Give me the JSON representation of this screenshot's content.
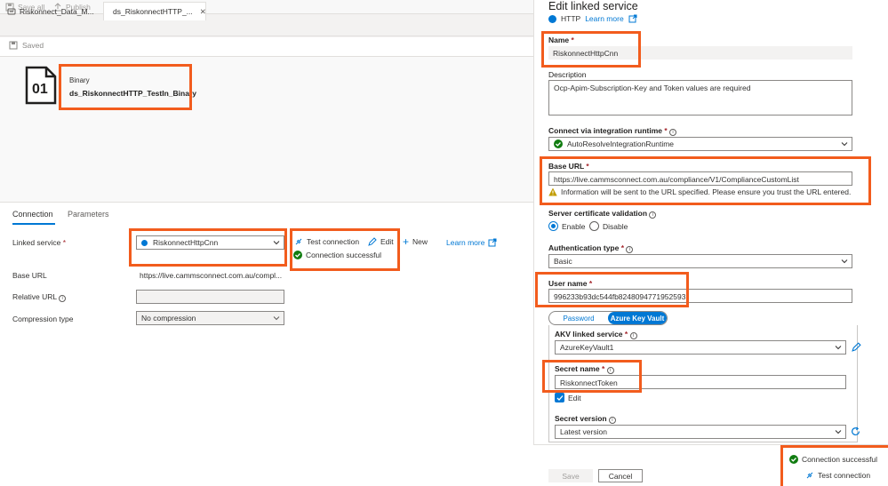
{
  "toolbar": {
    "save_all": "Save all",
    "publish": "Publish"
  },
  "tabs": [
    {
      "label": "Riskonnect_Data_M..."
    },
    {
      "label": "ds_RiskonnectHTTP_..."
    }
  ],
  "saved_label": "Saved",
  "dataset": {
    "icon_text": "01",
    "type": "Binary",
    "name": "ds_RiskonnectHTTP_TestIn_Binary"
  },
  "lower_tabs": {
    "connection": "Connection",
    "parameters": "Parameters"
  },
  "linked_service": {
    "label": "Linked service",
    "required": "*",
    "value": "RiskonnectHttpCnn",
    "test_connection": "Test connection",
    "edit": "Edit",
    "new": "New",
    "learn_more": "Learn more",
    "status": "Connection successful"
  },
  "base_url": {
    "label": "Base URL",
    "value": "https://live.cammsconnect.com.au/compl..."
  },
  "relative_url": {
    "label": "Relative URL"
  },
  "compression": {
    "label": "Compression type",
    "value": "No compression"
  },
  "panel": {
    "title": "Edit linked service",
    "type": "HTTP",
    "learn_more": "Learn more",
    "name": {
      "label": "Name",
      "required": "*",
      "value": "RiskonnectHttpCnn"
    },
    "description": {
      "label": "Description",
      "value": "Ocp-Apim-Subscription-Key and Token values are required"
    },
    "runtime": {
      "label": "Connect via integration runtime",
      "required": "*",
      "value": "AutoResolveIntegrationRuntime"
    },
    "base_url": {
      "label": "Base URL",
      "required": "*",
      "value": "https://live.cammsconnect.com.au/compliance/V1/ComplianceCustomList",
      "warning": "Information will be sent to the URL specified. Please ensure you trust the URL entered."
    },
    "cert": {
      "label": "Server certificate validation",
      "enable": "Enable",
      "disable": "Disable"
    },
    "auth": {
      "label": "Authentication type",
      "required": "*",
      "value": "Basic"
    },
    "user": {
      "label": "User name",
      "required": "*",
      "value": "996233b93dc544fb8248094771952593"
    },
    "toggle": {
      "password": "Password",
      "akv": "Azure Key Vault"
    },
    "akv_service": {
      "label": "AKV linked service",
      "required": "*",
      "value": "AzureKeyVault1"
    },
    "secret_name": {
      "label": "Secret name",
      "required": "*",
      "value": "RiskonnectToken"
    },
    "edit_checkbox": "Edit",
    "secret_version": {
      "label": "Secret version",
      "value": "Latest version"
    },
    "footer": {
      "save": "Save",
      "cancel": "Cancel",
      "status": "Connection successful",
      "test": "Test connection"
    }
  },
  "colors": {
    "accent": "#0078d4",
    "highlight": "#f25c1d",
    "success": "#107c10",
    "warning": "#c19c00"
  }
}
